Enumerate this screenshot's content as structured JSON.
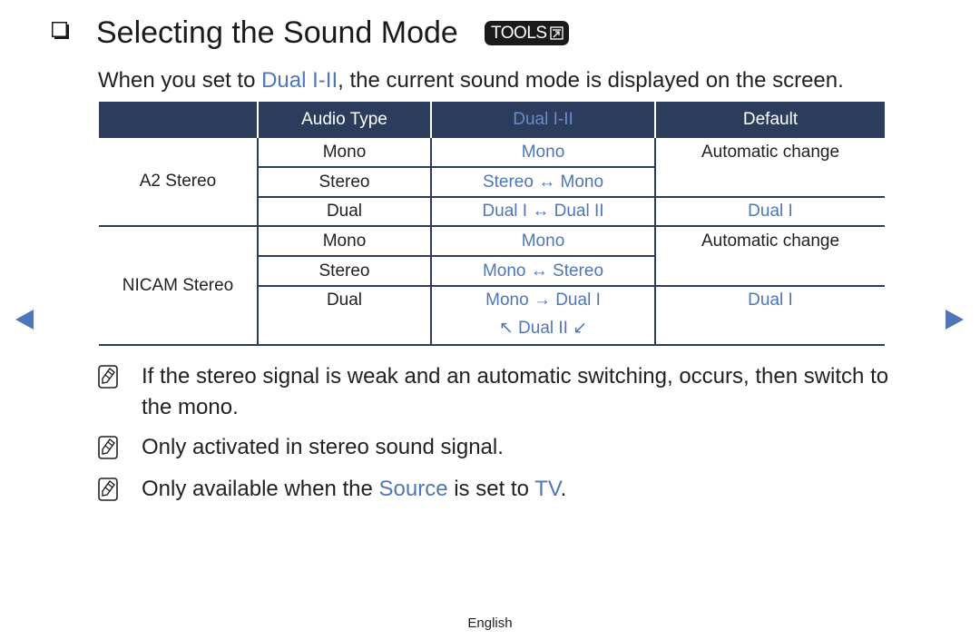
{
  "heading": {
    "title": "Selecting the Sound Mode",
    "tools_badge": "TOOLS"
  },
  "intro": {
    "prefix": "When you set to ",
    "highlight": "Dual I-II",
    "suffix": ", the current sound mode is displayed on the screen."
  },
  "table": {
    "headers": [
      "",
      "Audio Type",
      "Dual I-II",
      "Default"
    ],
    "groups": [
      {
        "name": "A2 Stereo",
        "rows": [
          {
            "audio_type": "Mono",
            "dual": "Mono",
            "default": "Automatic change"
          },
          {
            "audio_type": "Stereo",
            "dual": "Stereo ↔ Mono",
            "default": ""
          },
          {
            "audio_type": "Dual",
            "dual": "Dual I ↔ Dual II",
            "default": "Dual I"
          }
        ]
      },
      {
        "name": "NICAM Stereo",
        "rows": [
          {
            "audio_type": "Mono",
            "dual": "Mono",
            "default": "Automatic change"
          },
          {
            "audio_type": "Stereo",
            "dual": "Mono ↔ Stereo",
            "default": ""
          },
          {
            "audio_type": "Dual",
            "dual": "Mono → Dual I",
            "dual_line2": "↖ Dual II ↙",
            "default": "Dual I"
          }
        ]
      }
    ]
  },
  "notes": [
    {
      "text": "If the stereo signal is weak and an automatic switching, occurs, then switch to the mono."
    },
    {
      "text": "Only activated in stereo sound signal."
    },
    {
      "prefix": "Only available when the ",
      "highlight1": "Source",
      "middle": " is set to ",
      "highlight2": "TV",
      "suffix": "."
    }
  ],
  "navigation": {
    "prev": "previous-page",
    "next": "next-page"
  },
  "footer": {
    "language": "English"
  },
  "colors": {
    "accent_blue": "#4f76b8",
    "header_navy": "#2b3c5c"
  }
}
